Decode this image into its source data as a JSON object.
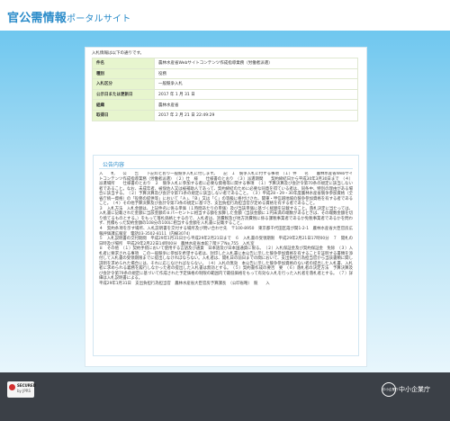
{
  "header": {
    "title_main": "官公需情報",
    "title_sub": "ポータルサイト"
  },
  "intro": "入札情報は以下の通りです。",
  "details": [
    {
      "label": "件名",
      "value": "農林水産省Webサイトコンテンツ作成指導業務（労働者派遣）"
    },
    {
      "label": "種別",
      "value": "役務"
    },
    {
      "label": "入札区分",
      "value": "一般競争入札"
    },
    {
      "label": "公示日または更新日",
      "value": "2017 年 1 月 31 日"
    },
    {
      "label": "組織",
      "value": "農林水産省"
    },
    {
      "label": "取得日",
      "value": "2017 年 2 月 21 日 22:49:29"
    }
  ],
  "notice": {
    "title": "公告内容",
    "paragraphs": [
      "入　　札　　公　　告　　下記のとおり一般競争入札に付します。　　記　１　競争入札に付する事項　（１）件　　名　　農林水産省Webサイトコンテンツ作成指導業務（労働者派遣）　（２）仕　様　　仕様書のとおり　（３）派遣期間　　契約締結日から平成30年3月30日まで　（４）派遣場所　　仕様書のとおり　２　競争入札に参加する者に必要な資格等に関する事項　（１）予算決算及び会計令第70条の規定に該当しない者であること。なお、未成年者、被保佐人又は被補助人であって、契約締結のために必要な同意を得ている者は、同条中、特別の理由がある場合に該当する。　（２）予算決算及び会計令第71条の規定に該当しない者であること。　（３）平成28・29・30年度農林水産省競争参加資格（全省庁統一資格）の「役務の提供等」において「Ａ」、「Ｂ」又は「Ｃ」の等級に格付けされ、関東・甲信越地域の競争参加資格を有する者であること。　（４）その他予算決算及び会計令第73条の規定に基づき、支出負担行為担当官が定める資格を有する者であること。",
      "３　入札方法　入札金額は、上記件名に係る単価（１時間あたりの単価）及び当該単価に基づく総額を記載すること。落札決定に当たっては、入札書に記載された金額に当該金額の８パーセントに相当する額を加算した金額（当該金額に１円未満の端数があるときは、その端数金額を切り捨てるものとする。）をもって落札価格とするので、入札者は、消費税及び地方消費税に係る課税事業者であるか免税事業者であるかを問わず、見積もった契約金額の108分の100に相当する金額を入札書に記載すること。",
      "４　契約条項を示す場所、入札説明書を交付する場所及び問い合わせ先　〒100-8950　東京都千代田区霞が関1-2-1　農林水産省大臣官房広報評価課広報室　電話03-3502-8111（内線3074）",
      "５　入札説明書の交付期間　平成29年1月31日から平成29年2月21日まで　６　入札書の受領期限　平成29年2月21日17時00分　７　開札の日時及び場所　平成29年2月22日14時00分　農林水産省本館７階ドアNo.755　入札室",
      "８　その他　（１）契約手続において使用する言語及び通貨　日本語及び日本国通貨に限る。　（２）入札保証金及び契約保証金　免除　（３）入札者に要求される事項　この一般競争に参加を希望する者は、封印した入札書に本公告に示した競争参加資格を有することを証明する書類を添付して入札書の受領期限までに提出しなければならない。入札者は、開札日の前日までの間において、支出負担行為担当官から当該書類に関し説明を求められた場合には、それに応じなければならない。　（４）入札の無効　本公告に示した競争参加資格のない者の提出した入札書、入札者に求められる義務を履行しなかった者の提出した入札書は無効とする。　（５）契約書作成の要否　要　（６）落札者の決定方法　予算決算及び会計令第79条の規定に基づいて作成された予定価格の制限の範囲内で最低価格をもって有効な入札を行った入札者を落札者とする。　（７）詳細は入札説明書による。",
      "平成29年1月31日　支出負担行為担当官　農林水産省大臣官房予算課長　（公印省略）　競　　入"
    ]
  },
  "footer": {
    "seal_line1": "SECURED",
    "seal_line2": "by JPRS",
    "agency_mark": "中小企業庁",
    "agency_name": "中小企業庁"
  }
}
